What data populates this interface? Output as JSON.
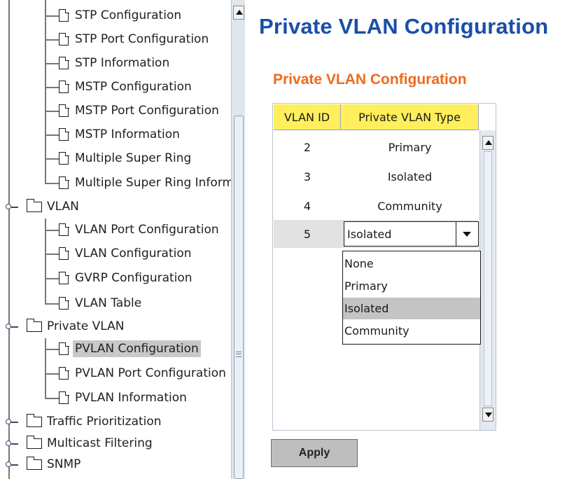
{
  "tree": {
    "items": [
      {
        "label": "STP Configuration",
        "type": "doc"
      },
      {
        "label": "STP Port Configuration",
        "type": "doc"
      },
      {
        "label": "STP Information",
        "type": "doc"
      },
      {
        "label": "MSTP Configuration",
        "type": "doc"
      },
      {
        "label": "MSTP Port Configuration",
        "type": "doc"
      },
      {
        "label": "MSTP Information",
        "type": "doc"
      },
      {
        "label": "Multiple Super Ring",
        "type": "doc"
      },
      {
        "label": "Multiple Super Ring Information",
        "type": "doc"
      },
      {
        "label": "VLAN",
        "type": "folder",
        "expanded": true
      },
      {
        "label": "VLAN Port Configuration",
        "type": "doc"
      },
      {
        "label": "VLAN Configuration",
        "type": "doc"
      },
      {
        "label": "GVRP Configuration",
        "type": "doc"
      },
      {
        "label": "VLAN Table",
        "type": "doc"
      },
      {
        "label": "Private VLAN",
        "type": "folder",
        "expanded": true
      },
      {
        "label": "PVLAN Configuration",
        "type": "doc",
        "selected": true
      },
      {
        "label": "PVLAN Port Configuration",
        "type": "doc"
      },
      {
        "label": "PVLAN Information",
        "type": "doc"
      },
      {
        "label": "Traffic Prioritization",
        "type": "folder",
        "expanded": false
      },
      {
        "label": "Multicast Filtering",
        "type": "folder",
        "expanded": false
      },
      {
        "label": "SNMP",
        "type": "folder",
        "expanded": false
      }
    ]
  },
  "page": {
    "title": "Private VLAN Configuration",
    "section_title": "Private VLAN Configuration"
  },
  "table": {
    "headers": [
      "VLAN ID",
      "Private VLAN Type"
    ],
    "rows": [
      {
        "vlan_id": "2",
        "type": "Primary"
      },
      {
        "vlan_id": "3",
        "type": "Isolated"
      },
      {
        "vlan_id": "4",
        "type": "Community"
      },
      {
        "vlan_id": "5",
        "type": "Isolated"
      }
    ],
    "header_color": "#ffef5c"
  },
  "combo": {
    "value": "Isolated",
    "options": [
      "None",
      "Primary",
      "Isolated",
      "Community"
    ],
    "selected_option": "Isolated"
  },
  "apply_label": "Apply",
  "colors": {
    "title": "#1a4fa8",
    "section_title": "#f06a1a"
  }
}
